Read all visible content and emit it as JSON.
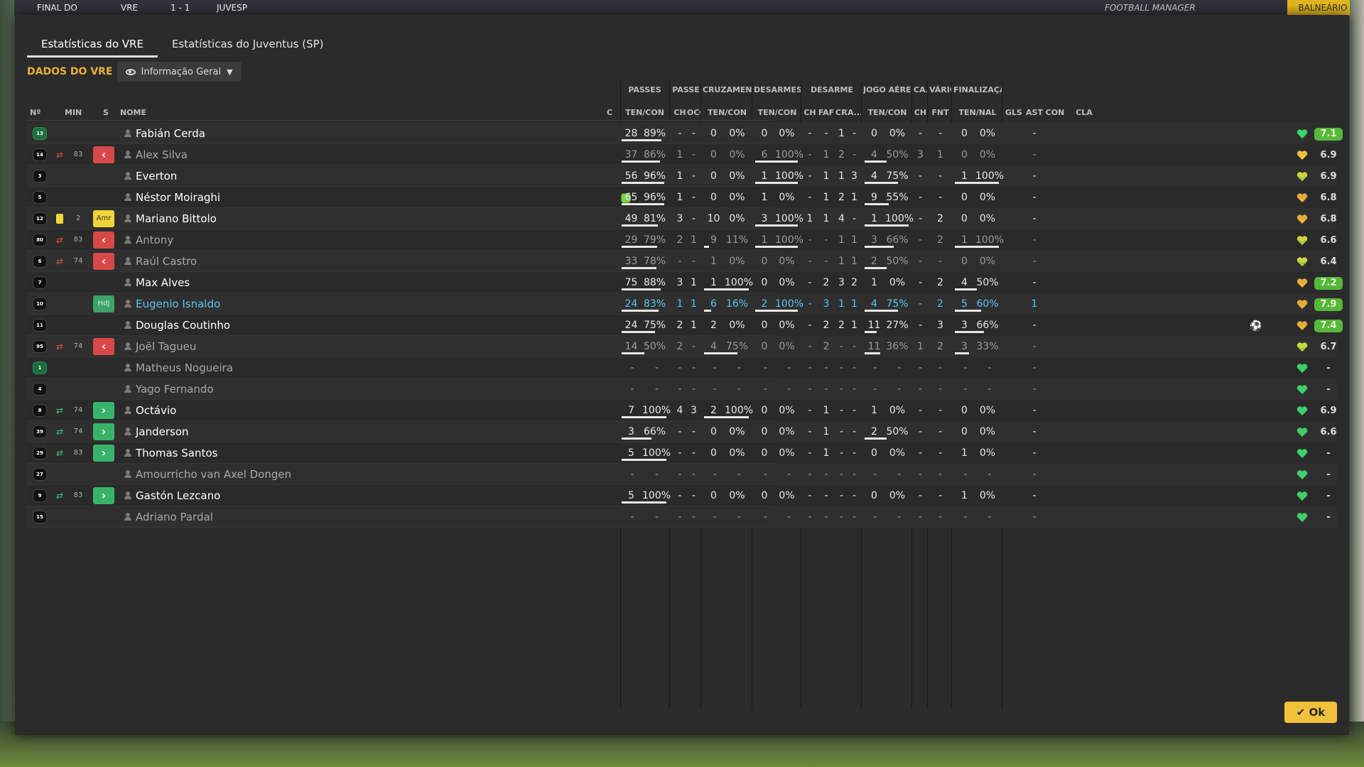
{
  "background": {
    "topbar_final": "FINAL DO",
    "topbar_home": "VRE",
    "topbar_score": "1 - 1",
    "topbar_away": "JUVESP",
    "topbar_brand": "FOOTBALL MANAGER",
    "topbar_right": "BALNEÁRIO"
  },
  "tabs": [
    "Estatísticas do VRE",
    "Estatísticas do Juventus (SP)"
  ],
  "section_title": "DADOS DO VRE",
  "view_dropdown": "Informação Geral",
  "group_headers": [
    "PASSES",
    "PASSE",
    "CRUZAMENTOS",
    "DESARMES",
    "DESARME",
    "JOGO AÉREO",
    "CA...",
    "VÁRIOS",
    "FINALIZAÇÃO"
  ],
  "left_headers": {
    "num": "Nº",
    "min": "MIN",
    "s": "S",
    "name": "NOME",
    "c": "C"
  },
  "sub_headers": [
    "TEN/CON",
    "CH",
    "OCG",
    "TEN/CON",
    "TEN/CON",
    "CH",
    "FAF",
    "CRT",
    "A...",
    "TEN/CON",
    "CH",
    "FNT",
    "TEN/NAL",
    "GLS",
    "AST",
    "CON",
    "CLA"
  ],
  "ok_label": "Ok",
  "icons": {
    "eye": "eye-icon",
    "chevron": "chevron-down-icon",
    "check": "check-icon",
    "ball": "football-icon",
    "heart": "heart-icon"
  },
  "players": [
    {
      "num": "13",
      "gk": true,
      "ev": "",
      "min": "",
      "s": "",
      "name": "Fabián Cerda",
      "style": "",
      "cond": false,
      "pas": [
        "28",
        "89%",
        0.89
      ],
      "ch": "-",
      "ocg": "-",
      "cru": [
        "0",
        "0%",
        0
      ],
      "des": [
        "0",
        "0%",
        0
      ],
      "d": [
        "-",
        "-",
        "1",
        "-"
      ],
      "ja": [
        "0",
        "0%",
        0
      ],
      "ca": "-",
      "fnt": "-",
      "fin": [
        "0",
        "0%",
        0
      ],
      "gls": "",
      "ast": "-",
      "heart": "green",
      "cla": "7.1",
      "claGood": true
    },
    {
      "num": "14",
      "ev": "off",
      "min": "83",
      "s": "off",
      "name": "Alex Silva",
      "style": "dim",
      "pas": [
        "37",
        "86%",
        0.86
      ],
      "ch": "1",
      "ocg": "-",
      "cru": [
        "0",
        "0%",
        0
      ],
      "des": [
        "6",
        "100%",
        1
      ],
      "d": [
        "-",
        "1",
        "2",
        "-"
      ],
      "ja": [
        "4",
        "50%",
        0.5
      ],
      "ca": "3",
      "fnt": "1",
      "fin": [
        "0",
        "0%",
        0
      ],
      "gls": "",
      "ast": "-",
      "heart": "yellow",
      "cla": "6.9"
    },
    {
      "num": "3",
      "ev": "",
      "min": "",
      "s": "",
      "name": "Everton",
      "style": "",
      "pas": [
        "56",
        "96%",
        0.96
      ],
      "ch": "1",
      "ocg": "-",
      "cru": [
        "0",
        "0%",
        0
      ],
      "des": [
        "1",
        "100%",
        1
      ],
      "d": [
        "-",
        "1",
        "1",
        "3"
      ],
      "ja": [
        "4",
        "75%",
        0.75
      ],
      "ca": "-",
      "fnt": "-",
      "fin": [
        "1",
        "100%",
        1
      ],
      "gls": "",
      "ast": "-",
      "heart": "yellowgreen",
      "cla": "6.9"
    },
    {
      "num": "5",
      "ev": "",
      "min": "",
      "s": "",
      "name": "Néstor Moiraghi",
      "style": "",
      "cond": true,
      "pas": [
        "65",
        "96%",
        0.96
      ],
      "ch": "1",
      "ocg": "-",
      "cru": [
        "0",
        "0%",
        0
      ],
      "des": [
        "1",
        "0%",
        0
      ],
      "d": [
        "-",
        "1",
        "2",
        "1"
      ],
      "ja": [
        "9",
        "55%",
        0.55
      ],
      "ca": "-",
      "fnt": "-",
      "fin": [
        "0",
        "0%",
        0
      ],
      "gls": "",
      "ast": "-",
      "heart": "orange",
      "cla": "6.8"
    },
    {
      "num": "12",
      "ev": "card",
      "min": "2",
      "s": "amr",
      "name": "Mariano Bittolo",
      "style": "",
      "pas": [
        "49",
        "81%",
        0.81
      ],
      "ch": "3",
      "ocg": "-",
      "cru": [
        "10",
        "0%",
        0
      ],
      "des": [
        "3",
        "100%",
        1
      ],
      "d": [
        "1",
        "1",
        "4",
        "-"
      ],
      "ja": [
        "1",
        "100%",
        1
      ],
      "ca": "-",
      "fnt": "2",
      "fin": [
        "0",
        "0%",
        0
      ],
      "gls": "",
      "ast": "-",
      "heart": "orange",
      "cla": "6.8"
    },
    {
      "num": "80",
      "ev": "off",
      "min": "83",
      "s": "off",
      "name": "Antony",
      "style": "dim",
      "pas": [
        "29",
        "79%",
        0.79
      ],
      "ch": "2",
      "ocg": "1",
      "cru": [
        "9",
        "11%",
        0.11
      ],
      "des": [
        "1",
        "100%",
        1
      ],
      "d": [
        "-",
        "-",
        "1",
        "1"
      ],
      "ja": [
        "3",
        "66%",
        0.66
      ],
      "ca": "-",
      "fnt": "2",
      "fin": [
        "1",
        "100%",
        1
      ],
      "gls": "",
      "ast": "-",
      "heart": "yellowgreen",
      "cla": "6.6"
    },
    {
      "num": "6",
      "ev": "off",
      "min": "74",
      "s": "off",
      "name": "Raúl Castro",
      "style": "dim",
      "pas": [
        "33",
        "78%",
        0.78
      ],
      "ch": "-",
      "ocg": "-",
      "cru": [
        "1",
        "0%",
        0
      ],
      "des": [
        "0",
        "0%",
        0
      ],
      "d": [
        "-",
        "-",
        "1",
        "1"
      ],
      "ja": [
        "2",
        "50%",
        0.5
      ],
      "ca": "-",
      "fnt": "-",
      "fin": [
        "0",
        "0%",
        0
      ],
      "gls": "",
      "ast": "-",
      "heart": "yellowgreen",
      "cla": "6.4"
    },
    {
      "num": "7",
      "ev": "",
      "min": "",
      "s": "",
      "name": "Max Alves",
      "style": "",
      "pas": [
        "75",
        "88%",
        0.88
      ],
      "ch": "3",
      "ocg": "1",
      "cru": [
        "1",
        "100%",
        1
      ],
      "des": [
        "0",
        "0%",
        0
      ],
      "d": [
        "-",
        "2",
        "3",
        "2"
      ],
      "ja": [
        "1",
        "0%",
        0
      ],
      "ca": "-",
      "fnt": "2",
      "fin": [
        "4",
        "50%",
        0.5
      ],
      "gls": "",
      "ast": "-",
      "heart": "orange",
      "cla": "7.2",
      "claGood": true
    },
    {
      "num": "10",
      "ev": "",
      "min": "",
      "s": "hdj",
      "name": "Eugenio Isnaldo",
      "style": "blue",
      "pas": [
        "24",
        "83%",
        0.83
      ],
      "ch": "1",
      "ocg": "1",
      "cru": [
        "6",
        "16%",
        0.16
      ],
      "des": [
        "2",
        "100%",
        1
      ],
      "d": [
        "-",
        "3",
        "1",
        "1"
      ],
      "ja": [
        "4",
        "75%",
        0.75
      ],
      "ca": "-",
      "fnt": "2",
      "fin": [
        "5",
        "60%",
        0.6
      ],
      "gls": "",
      "ast": "1",
      "heart": "orange",
      "cla": "7.9",
      "claGood": true
    },
    {
      "num": "11",
      "ev": "",
      "min": "",
      "s": "",
      "name": "Douglas Coutinho",
      "style": "",
      "pas": [
        "24",
        "75%",
        0.75
      ],
      "ch": "2",
      "ocg": "1",
      "cru": [
        "2",
        "0%",
        0
      ],
      "des": [
        "0",
        "0%",
        0
      ],
      "d": [
        "-",
        "2",
        "2",
        "1"
      ],
      "ja": [
        "11",
        "27%",
        0.27
      ],
      "ca": "-",
      "fnt": "3",
      "fin": [
        "3",
        "66%",
        0.66
      ],
      "gls": "ball",
      "ast": "-",
      "heart": "orange",
      "cla": "7.4",
      "claGood": true
    },
    {
      "num": "95",
      "ev": "off",
      "min": "74",
      "s": "off",
      "name": "Joël Tagueu",
      "style": "dim",
      "pas": [
        "14",
        "50%",
        0.5
      ],
      "ch": "2",
      "ocg": "-",
      "cru": [
        "4",
        "75%",
        0.75
      ],
      "des": [
        "0",
        "0%",
        0
      ],
      "d": [
        "-",
        "2",
        "-",
        "-"
      ],
      "ja": [
        "11",
        "36%",
        0.36
      ],
      "ca": "1",
      "fnt": "2",
      "fin": [
        "3",
        "33%",
        0.33
      ],
      "gls": "",
      "ast": "-",
      "heart": "yellowgreen",
      "cla": "6.7"
    },
    {
      "num": "1",
      "gk": true,
      "ev": "",
      "min": "",
      "s": "",
      "name": "Matheus Nogueira",
      "style": "dim",
      "empty": true,
      "heart": "green",
      "cla": "-"
    },
    {
      "num": "4",
      "ev": "",
      "min": "",
      "s": "",
      "name": "Yago Fernando",
      "style": "dim",
      "empty": true,
      "heart": "green",
      "cla": "-"
    },
    {
      "num": "8",
      "ev": "in",
      "min": "74",
      "s": "on",
      "name": "Octávio",
      "style": "",
      "pas": [
        "7",
        "100%",
        1
      ],
      "ch": "4",
      "ocg": "3",
      "cru": [
        "2",
        "100%",
        1
      ],
      "des": [
        "0",
        "0%",
        0
      ],
      "d": [
        "-",
        "1",
        "-",
        "-"
      ],
      "ja": [
        "1",
        "0%",
        0
      ],
      "ca": "-",
      "fnt": "-",
      "fin": [
        "0",
        "0%",
        0
      ],
      "gls": "",
      "ast": "-",
      "heart": "green",
      "cla": "6.9"
    },
    {
      "num": "39",
      "ev": "in",
      "min": "74",
      "s": "on",
      "name": "Janderson",
      "style": "",
      "pas": [
        "3",
        "66%",
        0.66
      ],
      "ch": "-",
      "ocg": "-",
      "cru": [
        "0",
        "0%",
        0
      ],
      "des": [
        "0",
        "0%",
        0
      ],
      "d": [
        "-",
        "1",
        "-",
        "-"
      ],
      "ja": [
        "2",
        "50%",
        0.5
      ],
      "ca": "-",
      "fnt": "-",
      "fin": [
        "0",
        "0%",
        0
      ],
      "gls": "",
      "ast": "-",
      "heart": "green",
      "cla": "6.6"
    },
    {
      "num": "29",
      "ev": "in",
      "min": "83",
      "s": "on",
      "name": "Thomas Santos",
      "style": "",
      "pas": [
        "5",
        "100%",
        1
      ],
      "ch": "-",
      "ocg": "-",
      "cru": [
        "0",
        "0%",
        0
      ],
      "des": [
        "0",
        "0%",
        0
      ],
      "d": [
        "-",
        "1",
        "-",
        "-"
      ],
      "ja": [
        "0",
        "0%",
        0
      ],
      "ca": "-",
      "fnt": "-",
      "fin": [
        "1",
        "0%",
        0
      ],
      "gls": "",
      "ast": "-",
      "heart": "green",
      "cla": "-"
    },
    {
      "num": "27",
      "ev": "",
      "min": "",
      "s": "",
      "name": "Amourricho van Axel Dongen",
      "style": "dim",
      "empty": true,
      "heart": "green",
      "cla": "-"
    },
    {
      "num": "9",
      "ev": "in",
      "min": "83",
      "s": "on",
      "name": "Gastón Lezcano",
      "style": "",
      "pas": [
        "5",
        "100%",
        1
      ],
      "ch": "-",
      "ocg": "-",
      "cru": [
        "0",
        "0%",
        0
      ],
      "des": [
        "0",
        "0%",
        0
      ],
      "d": [
        "-",
        "-",
        "-",
        "-"
      ],
      "ja": [
        "0",
        "0%",
        0
      ],
      "ca": "-",
      "fnt": "-",
      "fin": [
        "1",
        "0%",
        0
      ],
      "gls": "",
      "ast": "-",
      "heart": "green",
      "cla": "-"
    },
    {
      "num": "15",
      "ev": "",
      "min": "",
      "s": "",
      "name": "Adriano Pardal",
      "style": "dim",
      "empty": true,
      "heart": "green",
      "cla": "-"
    }
  ],
  "colors": {
    "accent": "#e8b233",
    "off": "#d94848",
    "on": "#39b36b",
    "blue": "#5bc5f1",
    "ok": "#f2c13b"
  }
}
